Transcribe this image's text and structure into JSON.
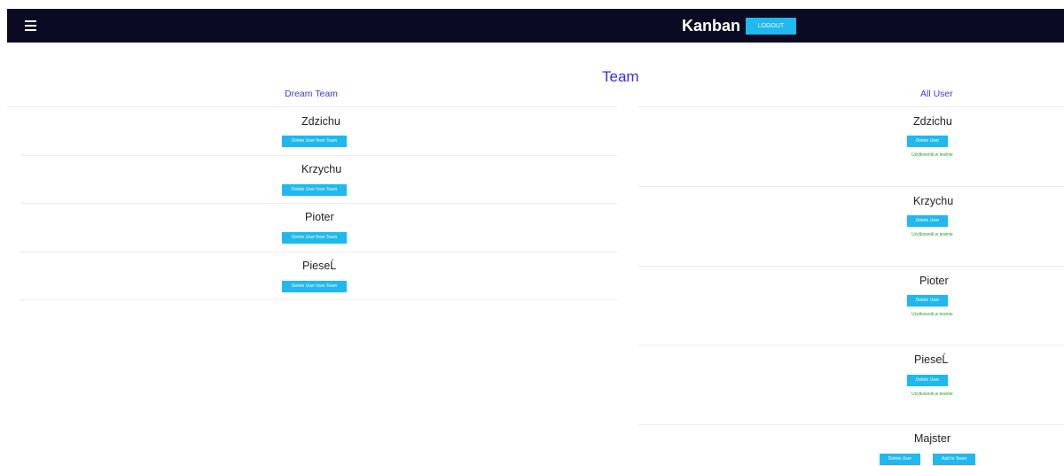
{
  "nav": {
    "brand": "Kanban",
    "logout_label": "LOGOUT"
  },
  "page": {
    "title": "Team"
  },
  "team": {
    "title": "Dream Team",
    "members": [
      {
        "name": "Zdzichu",
        "action": "Delete User from Team"
      },
      {
        "name": "Krzychu",
        "action": "Delete User from Team"
      },
      {
        "name": "Pioter",
        "action": "Delete User from Team"
      },
      {
        "name": "PieseĹ",
        "action": "Delete User from Team"
      }
    ]
  },
  "all_users": {
    "title": "All User",
    "users": [
      {
        "name": "Zdzichu",
        "delete_label": "Delete User",
        "status": "Użytkownik w teamie"
      },
      {
        "name": "Krzychu",
        "delete_label": "Delete User",
        "status": "Użytkownik w teamie"
      },
      {
        "name": "Pioter",
        "delete_label": "Delete User",
        "status": "Użytkownik w teamie"
      },
      {
        "name": "PieseĹ",
        "delete_label": "Delete User",
        "status": "Użytkownik w teamie"
      },
      {
        "name": "Majster",
        "delete_label": "Delete User",
        "add_label": "Add to Team"
      }
    ]
  },
  "colors": {
    "navbar": "#0a0b22",
    "button": "#1fb8ef",
    "title_blue": "#2f2fe8",
    "status_green": "#2f9a2f"
  }
}
